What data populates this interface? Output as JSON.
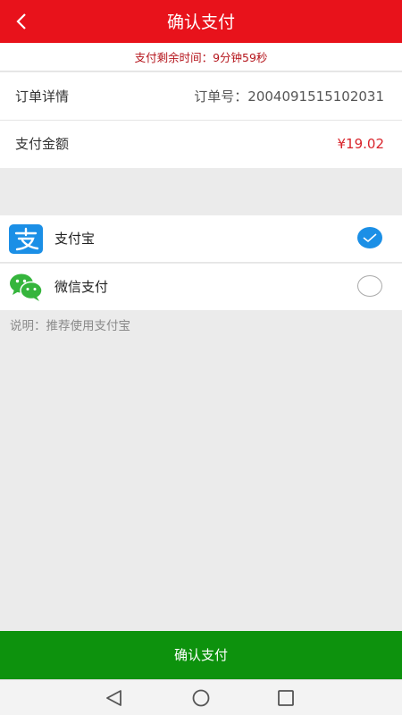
{
  "header": {
    "title": "确认支付"
  },
  "timer": {
    "text": "支付剩余时间：9分钟59秒"
  },
  "order": {
    "label": "订单详情",
    "value": "订单号：2004091515102031"
  },
  "amount": {
    "label": "支付金额",
    "value": "¥19.02"
  },
  "payment_methods": [
    {
      "label": "支付宝",
      "icon": "alipay-icon",
      "selected": true
    },
    {
      "label": "微信支付",
      "icon": "wechat-icon",
      "selected": false
    }
  ],
  "note": "说明：推荐使用支付宝",
  "confirm_button": {
    "label": "确认支付"
  },
  "colors": {
    "header": "#e8121b",
    "confirm": "#0d920d",
    "alipay": "#1b8fe6",
    "wechat": "#35b53c",
    "price": "#d9242b"
  },
  "navbar": {
    "icons": [
      "back-triangle-icon",
      "home-circle-icon",
      "recents-square-icon"
    ]
  }
}
